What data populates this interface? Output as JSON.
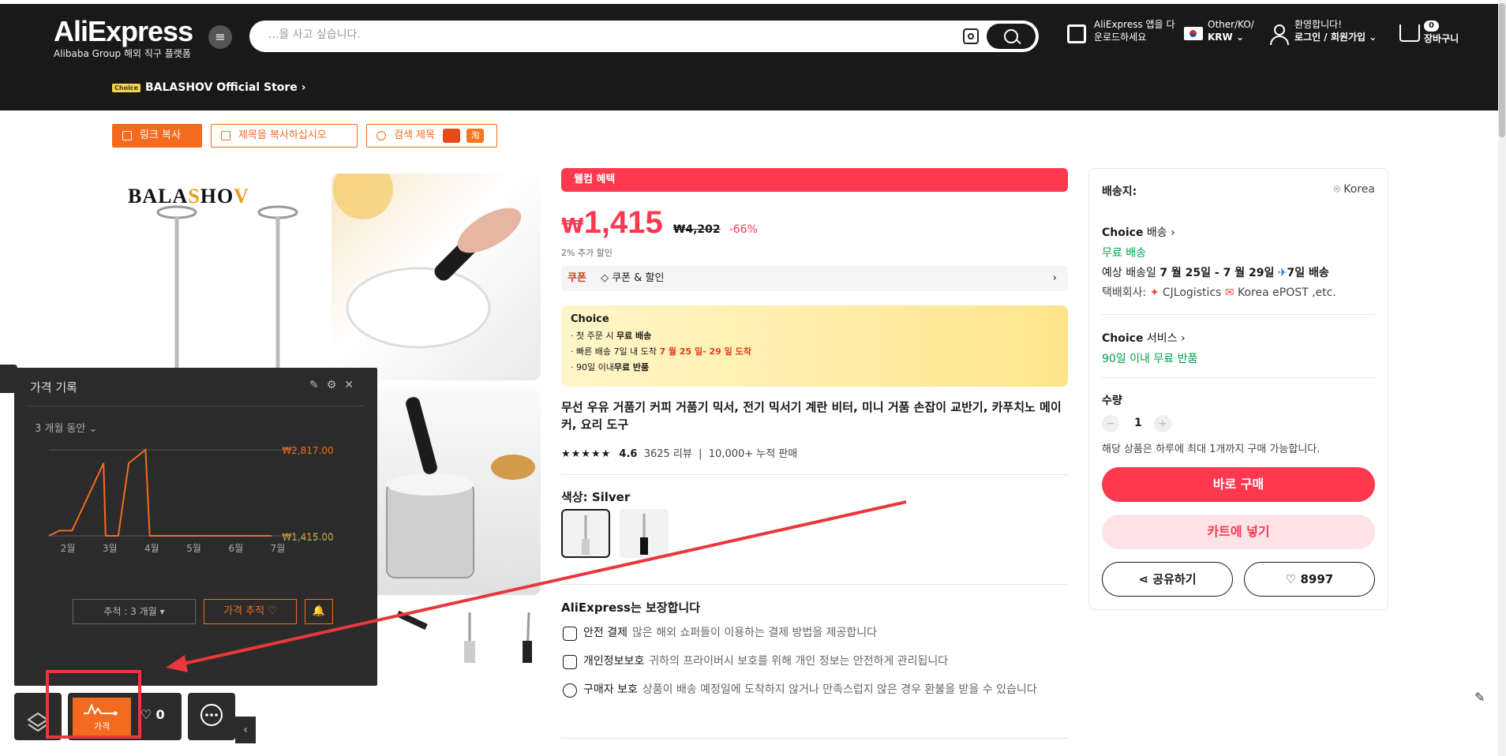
{
  "header": {
    "logo": "AliExpress",
    "logo_sub": "Alibaba Group 해외 직구 플랫폼",
    "search_placeholder": "...을 사고 싶습니다.",
    "app_line1": "AliExpress 앱을 다",
    "app_line2": "운로드하세요",
    "region_line1": "Other/KO/",
    "region_line2": "KRW",
    "user_line1": "환영합니다!",
    "user_line2": "로그인 / 회원가입",
    "cart_count": "0",
    "cart_label": "장바구니"
  },
  "store": {
    "choice_badge": "Choice",
    "name": "BALASHOV Official Store"
  },
  "tools": {
    "copy_link": "링크 복사",
    "copy_title": "제목을 복사하십시오",
    "search_title": "검색 제목",
    "tao_badge": "淘"
  },
  "images": {
    "brand_logo": "BALASHOV"
  },
  "product": {
    "welcome": "웰컴 혜택",
    "currency": "₩",
    "price": "1,415",
    "old_price": "₩4,202",
    "discount": "-66%",
    "extra_discount": "2% 추가 할인",
    "coupon_tag": "쿠폰",
    "coupon_text": "쿠폰 & 할인",
    "choice_title": "Choice",
    "choice_l1a": "· 첫 주문 시 ",
    "choice_l1b": "무료 배송",
    "choice_l2a": "· 빠른 배송 7일 내 도착 ",
    "choice_l2b": "7 월 25 일- 29 일 도착",
    "choice_l3a": "· 90일 이내",
    "choice_l3b": "무료 반품",
    "title": "무선 우유 거품기 커피 거품기 믹서, 전기 믹서기 계란 비터, 미니 거품 손잡이 교반기, 카푸치노 메이커, 요리 도구",
    "stars": "★★★★★",
    "rating": "4.6",
    "reviews": "3625 리뷰",
    "sold": "10,000+ 누적 판매",
    "color_label": "색상: Silver",
    "guarantee_title": "AliExpress는 보장합니다",
    "g1_title": "안전 결제",
    "g1_text": "많은 해외 쇼퍼들이 이용하는 결제 방법을 제공합니다",
    "g2_title": "개인정보보호",
    "g2_text": "귀하의 프라이버시 보호를 위해 개인 정보는 안전하게 관리됩니다",
    "g3_title": "구매자 보호",
    "g3_text": "상품이 배송 예정일에 도착하지 않거나 만족스럽지 않은 경우 환불을 받을 수 있습니다"
  },
  "sidebar": {
    "ship_to_label": "배송지:",
    "ship_to_value": "Korea",
    "choice": "Choice",
    "delivery_label": "배송",
    "free_shipping": "무료 배송",
    "eta_label": "예상 배송일",
    "eta_dates": "7 월 25일 - 7 월 29일",
    "eta_days": "7일 배송",
    "carrier_label": "택배회사:",
    "carrier1": "CJLogistics",
    "carrier2": "Korea ePOST ,etc.",
    "service_label": "서비스",
    "free_return": "90일 이내 무료 반품",
    "qty_label": "수량",
    "qty_value": "1",
    "qty_note": "해당 상품은 하루에 최대 1개까지 구매 가능합니다.",
    "buy_now": "바로 구매",
    "add_cart": "카트에 넣기",
    "share": "공유하기",
    "wishlist_count": "8997"
  },
  "price_history": {
    "title": "가격 기록",
    "range": "3 개월 동안",
    "track_label": "추적 : 3 개월",
    "watch_label": "가격 추적 ♡",
    "max_label": "₩2,817.00",
    "min_label": "₩1,415.00",
    "min_label_green": "₩1,415.00"
  },
  "chart_data": {
    "type": "line",
    "x": [
      "2월",
      "3월",
      "4월",
      "5월",
      "6월",
      "7월"
    ],
    "series": [
      {
        "points": [
          [
            0,
            1415
          ],
          [
            0.25,
            1500
          ],
          [
            0.55,
            1500
          ],
          [
            1.3,
            2600
          ],
          [
            1.35,
            1415
          ],
          [
            1.65,
            1415
          ],
          [
            1.9,
            2600
          ],
          [
            2.3,
            2817
          ],
          [
            2.4,
            1415
          ],
          [
            5.3,
            1415
          ]
        ]
      }
    ],
    "ylim": [
      1415,
      2817
    ],
    "line_color": "#f46b1f"
  },
  "dock": {
    "price_label": "가격",
    "fav_count": "0"
  }
}
